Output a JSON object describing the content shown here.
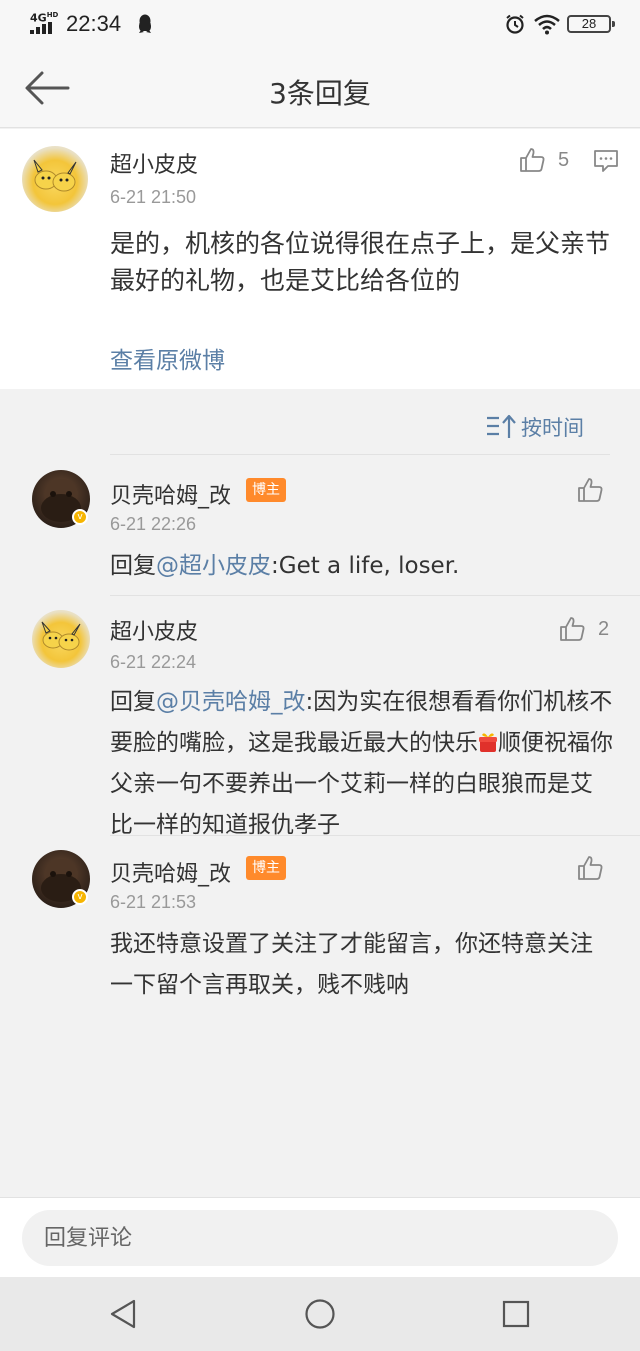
{
  "status_bar": {
    "network": "4G",
    "network_sup": "HD",
    "time": "22:34",
    "battery": "28",
    "icons": [
      "signal-icon",
      "qq-icon",
      "alarm-icon",
      "wifi-icon",
      "battery-icon"
    ]
  },
  "nav": {
    "title": "3条回复",
    "back_icon": "back-arrow-icon"
  },
  "original": {
    "username": "超小皮皮",
    "time": "6-21 21:50",
    "text": "是的，机核的各位说得很在点子上，是父亲节最好的礼物，也是艾比给各位的",
    "likes": "5",
    "view_original": "查看原微博"
  },
  "sort": {
    "label": "按时间",
    "icon": "sort-icon"
  },
  "replies": [
    {
      "username": "贝壳哈姆_改",
      "tag": "博主",
      "time": "6-21 22:26",
      "prefix": "回复",
      "mention": "@超小皮皮",
      "text": ":Get a life, loser.",
      "likes": ""
    },
    {
      "username": "超小皮皮",
      "tag": "",
      "time": "6-21 22:24",
      "prefix": "回复",
      "mention": "@贝壳哈姆_改",
      "text_part1": ":因为实在很想看看你们机核不要脸的嘴脸，这是我最近最大的快乐",
      "text_part2": "顺便祝福你父亲一句不要养出一个艾莉一样的白眼狼而是艾比一样的知道报仇孝子",
      "likes": "2"
    },
    {
      "username": "贝壳哈姆_改",
      "tag": "博主",
      "time": "6-21 21:53",
      "text": "我还特意设置了关注了才能留言，你还特意关注一下留个言再取关，贱不贱呐",
      "likes": ""
    }
  ],
  "input": {
    "placeholder": "回复评论"
  },
  "colors": {
    "link": "#5b7fa6",
    "host_tag": "#ff8a2b",
    "verified": "#f7b500"
  }
}
